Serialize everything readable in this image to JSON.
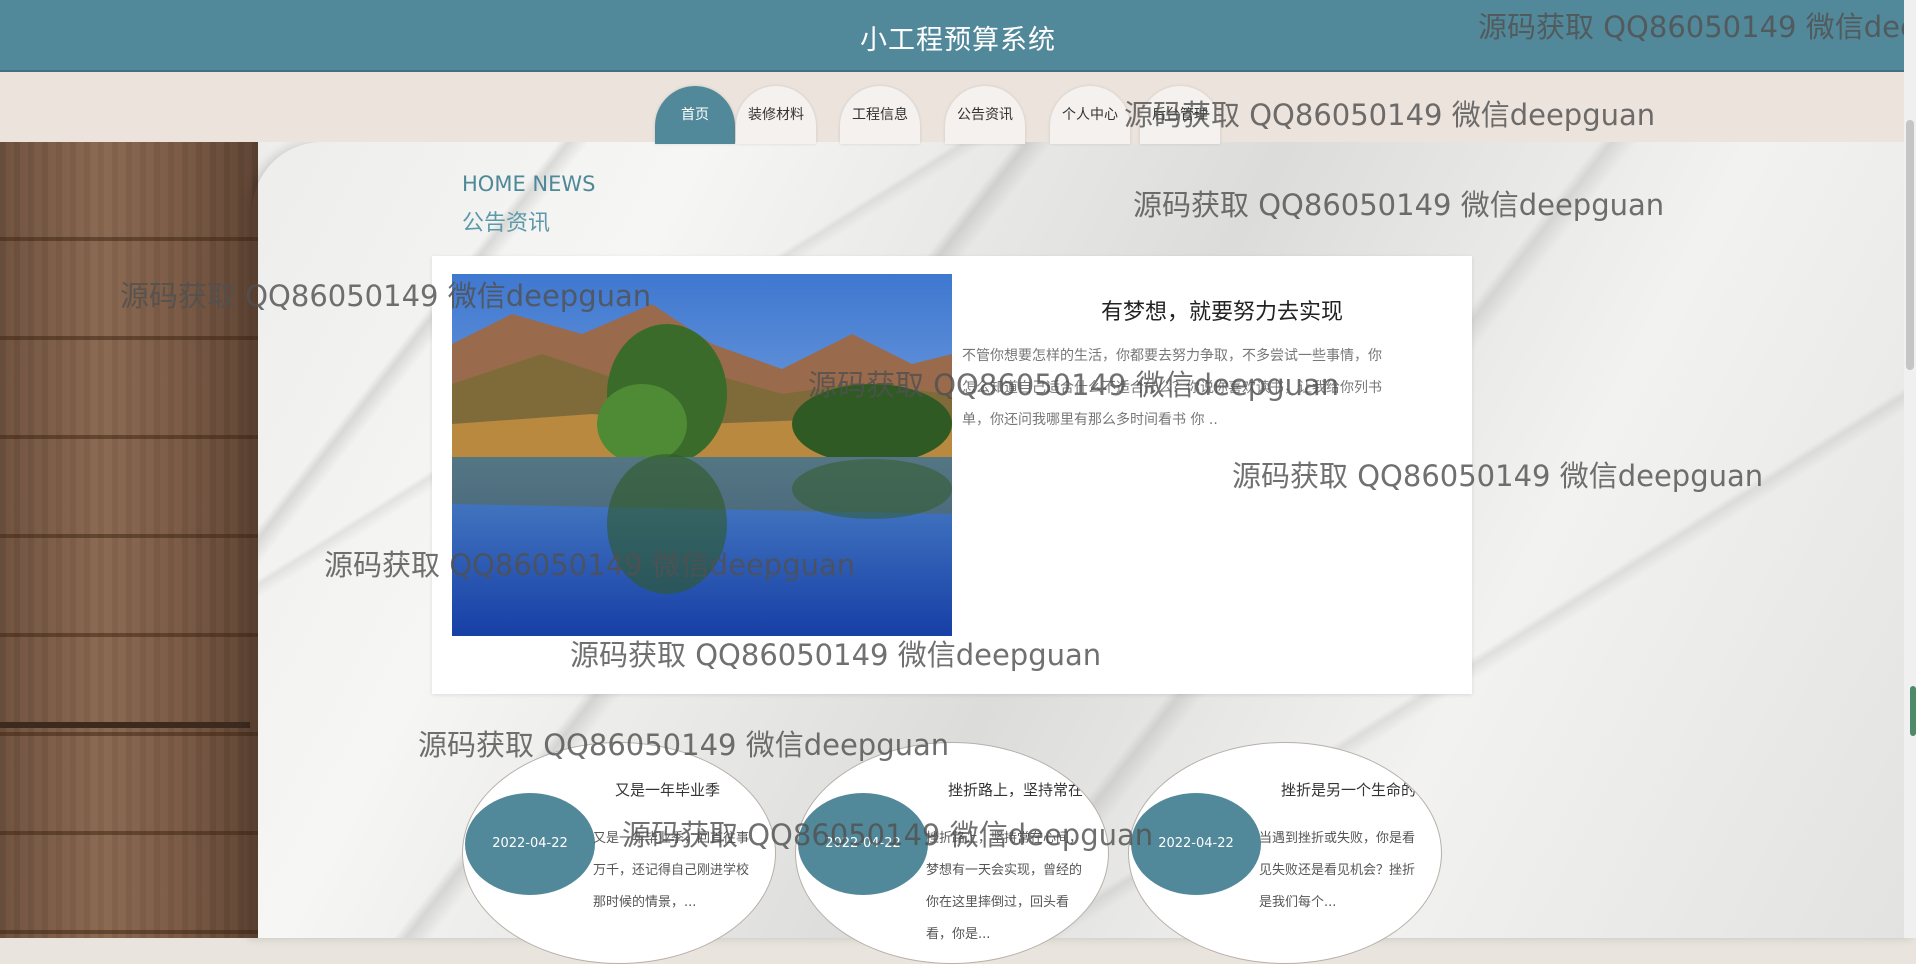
{
  "header": {
    "title": "小工程预算系统"
  },
  "nav": [
    {
      "label": "首页",
      "active": true
    },
    {
      "label": "装修材料",
      "active": false
    },
    {
      "label": "工程信息",
      "active": false
    },
    {
      "label": "公告资讯",
      "active": false
    },
    {
      "label": "个人中心",
      "active": false
    },
    {
      "label": "后台管理",
      "active": false
    }
  ],
  "news": {
    "heading_en": "HOME NEWS",
    "heading_cn": "公告资讯",
    "feature": {
      "title": "有梦想，就要努力去实现",
      "description": "不管你想要怎样的生活，你都要去努力争取，不多尝试一些事情，你怎么知道自己适合什么不适合什么？你说你喜欢读书，让我给你列书单，你还问我哪里有那么多时间看书  你 .."
    },
    "cards": [
      {
        "date": "2022-04-22",
        "title": "又是一年毕业季",
        "text": "又是一年毕业季，回首往事万千，还记得自己刚进学校那时候的情景，..."
      },
      {
        "date": "2022-04-22",
        "title": "挫折路上，坚持常在...",
        "text": "挫折路上，坚持常在心间，梦想有一天会实现，曾经的你在这里摔倒过，回头看看，你是..."
      },
      {
        "date": "2022-04-22",
        "title": "挫折是另一个生命的...",
        "text": "当遇到挫折或失败，你是看见失败还是看见机会？挫折是我们每个..."
      }
    ]
  },
  "watermark": "源码获取 QQ86050149 微信deepguan",
  "colors": {
    "primary": "#52899a",
    "nav_bg": "#ebe3dc"
  }
}
